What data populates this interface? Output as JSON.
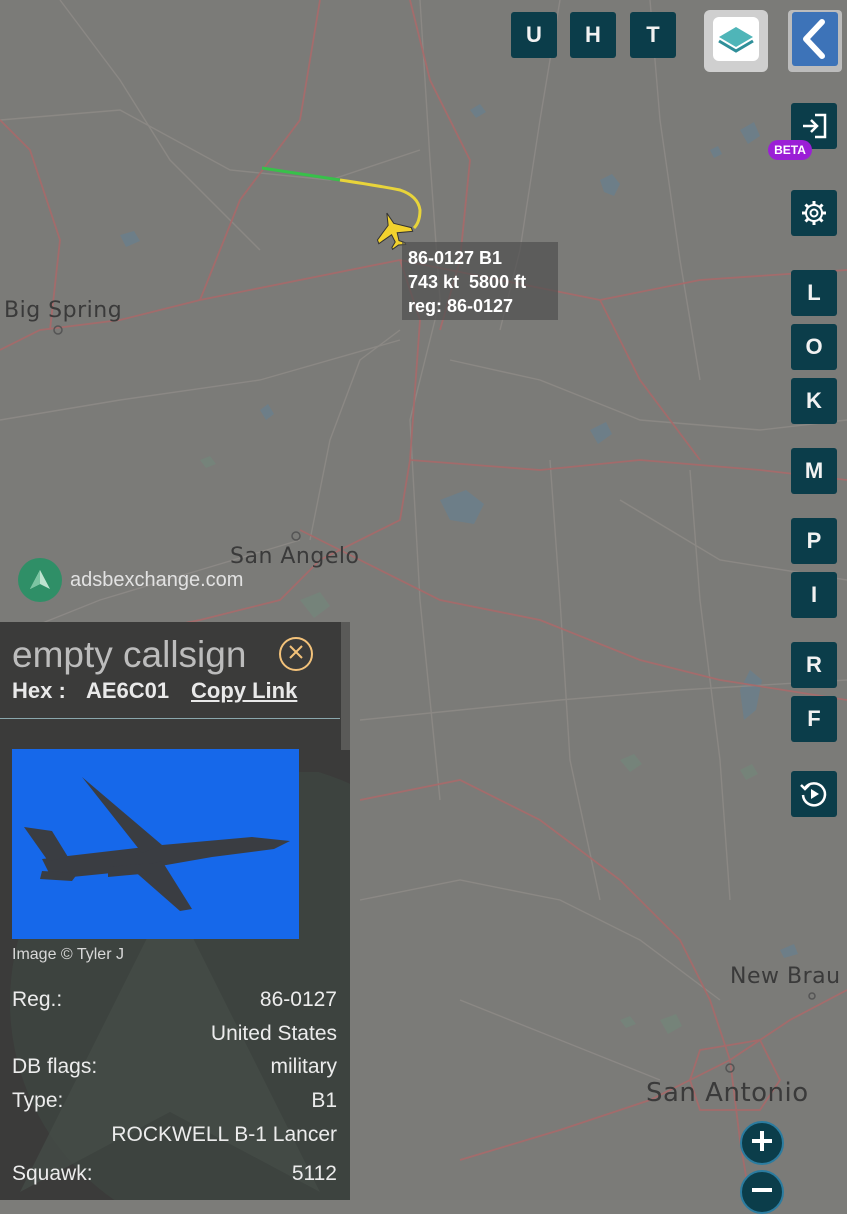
{
  "top_buttons": [
    "U",
    "H",
    "T"
  ],
  "side_buttons": [
    "L",
    "O",
    "K",
    "M",
    "P",
    "I",
    "R",
    "F"
  ],
  "beta_badge": "BETA",
  "map": {
    "cities": [
      "Big Spring",
      "San Angelo",
      "New Brau",
      "San Antonio"
    ],
    "attribution": "adsbexchange.com"
  },
  "aircraft_label": {
    "line1": "86-0127 B1",
    "line2": "743 kt  5800 ft",
    "line3": "reg: 86-0127"
  },
  "panel": {
    "callsign": "empty callsign",
    "hex_label": "Hex :",
    "hex_value": "AE6C01",
    "copy_link": "Copy Link",
    "image_credit": "Image © Tyler J",
    "rows": [
      {
        "key": "Reg.:",
        "value": "86-0127"
      },
      {
        "key": "",
        "value": "United States"
      },
      {
        "key": "DB flags:",
        "value": "military"
      },
      {
        "key": "Type:",
        "value": "B1"
      },
      {
        "key": "",
        "value": "ROCKWELL B-1 Lancer"
      },
      {
        "key": "Squawk:",
        "value": "5112"
      }
    ]
  },
  "icons": {
    "layers": "layers-icon",
    "back": "chevron-left-icon",
    "login": "login-icon",
    "settings": "gear-icon",
    "replay": "replay-icon",
    "close": "close-icon",
    "zoom_in": "plus-icon",
    "zoom_out": "minus-icon"
  },
  "colors": {
    "button_bg": "#0b3d4a",
    "beta": "#9b1fd6",
    "aircraft": "#f2d22e",
    "track_green": "#38c04a",
    "track_yellow": "#e8d43a"
  }
}
